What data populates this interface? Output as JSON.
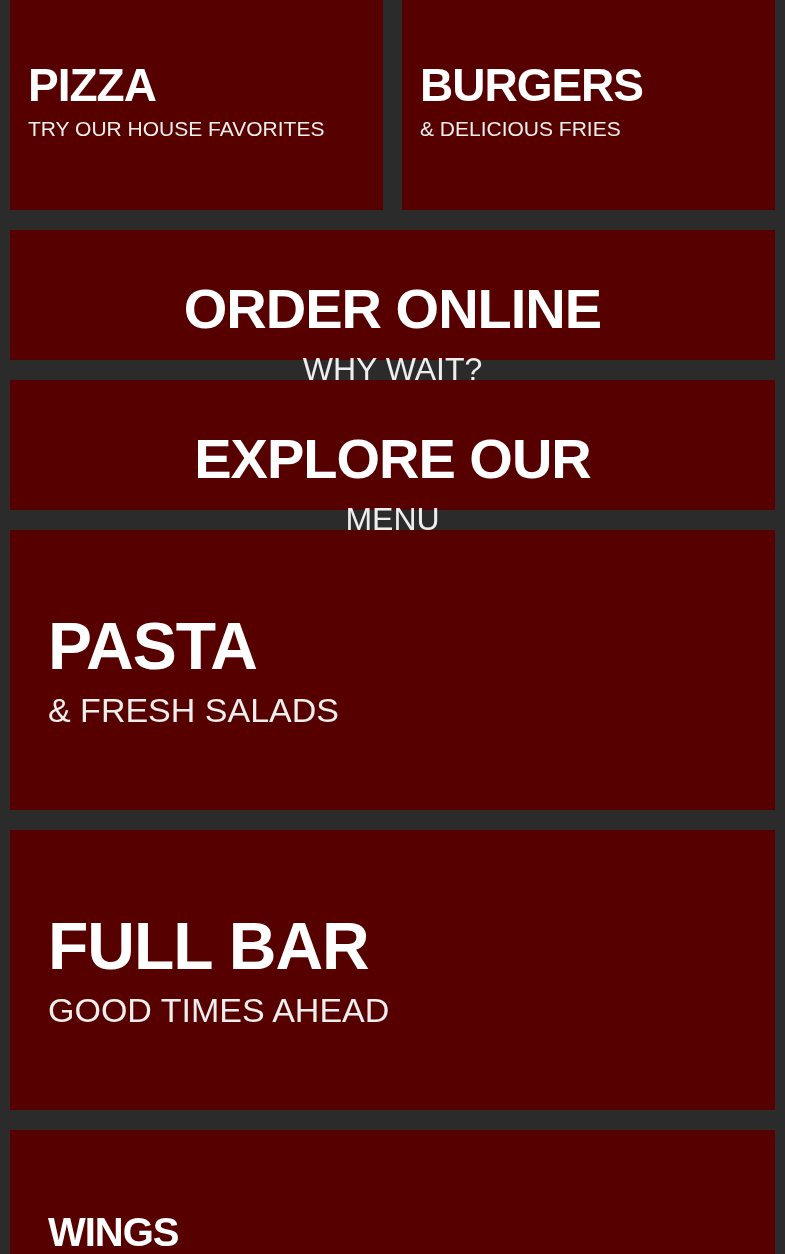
{
  "tiles": [
    {
      "kind": "half",
      "title": "PIZZA",
      "subtitle": "TRY OUR HOUSE FAVORITES"
    },
    {
      "kind": "half",
      "title": "BURGERS",
      "subtitle": "& DELICIOUS FRIES"
    },
    {
      "kind": "banner",
      "title": "ORDER ONLINE",
      "subtitle": "WHY WAIT?"
    },
    {
      "kind": "banner",
      "title": "EXPLORE OUR",
      "subtitle": "MENU"
    },
    {
      "kind": "feature",
      "title": "PASTA",
      "subtitle": "& FRESH SALADS"
    },
    {
      "kind": "feature",
      "title": "FULL BAR",
      "subtitle": "GOOD TIMES AHEAD"
    },
    {
      "kind": "feature",
      "title": "WINGS"
    }
  ]
}
